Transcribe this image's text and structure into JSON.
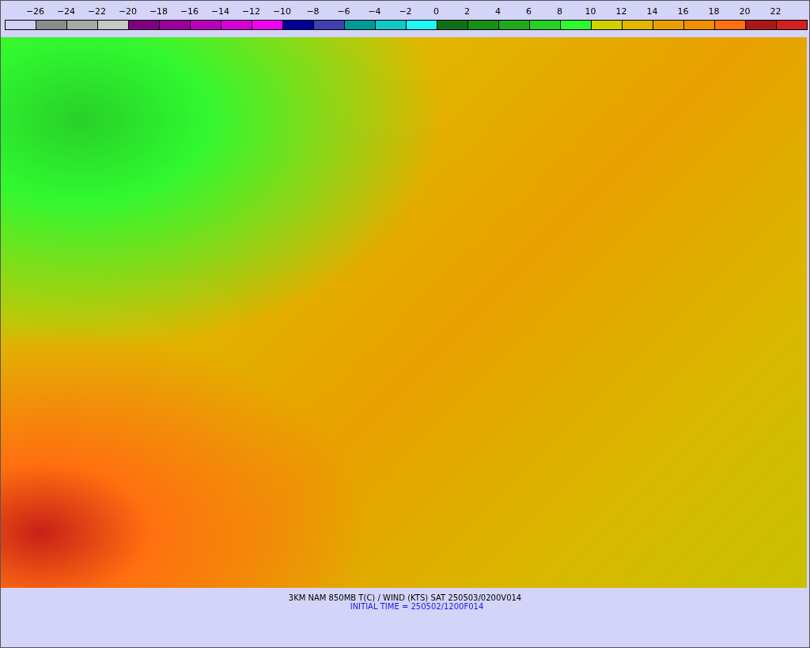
{
  "legend": {
    "labels": [
      "−26",
      "−24",
      "−22",
      "−20",
      "−18",
      "−16",
      "−14",
      "−12",
      "−10",
      "−8",
      "−6",
      "−4",
      "−2",
      "0",
      "2",
      "4",
      "6",
      "8",
      "10",
      "12",
      "14",
      "16",
      "18",
      "20",
      "22"
    ],
    "swatches": [
      {
        "color": "#d0d0f8"
      },
      {
        "color": "#8c8c8c"
      },
      {
        "color": "#a8a8a8"
      },
      {
        "color": "#c8c8c8"
      },
      {
        "color": "#800080"
      },
      {
        "color": "#9c009c"
      },
      {
        "color": "#b800b8"
      },
      {
        "color": "#d400d4"
      },
      {
        "color": "#f000f0"
      },
      {
        "color": "#000098"
      },
      {
        "color": "#4040b0"
      },
      {
        "color": "#009898"
      },
      {
        "color": "#10c8c8"
      },
      {
        "color": "#20f8f8"
      },
      {
        "color": "#107018"
      },
      {
        "color": "#189018"
      },
      {
        "color": "#20a820"
      },
      {
        "color": "#28d028"
      },
      {
        "color": "#30f830"
      },
      {
        "color": "#d0d000"
      },
      {
        "color": "#e0b800"
      },
      {
        "color": "#e8a000"
      },
      {
        "color": "#f09000"
      },
      {
        "color": "#ff7010"
      },
      {
        "color": "#a81818"
      },
      {
        "color": "#d02020"
      }
    ]
  },
  "caption": {
    "title": "3KM NAM 850MB T(C) / WIND (KTS) SAT 250503/0200V014",
    "initial_time": "INITIAL TIME = 250502/1200F014"
  }
}
